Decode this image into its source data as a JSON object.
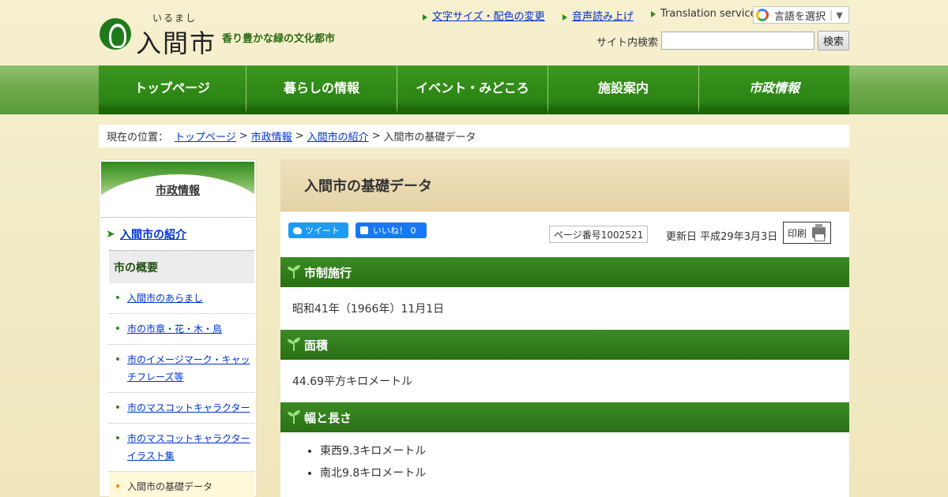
{
  "header": {
    "logo_ruby": "いるまし",
    "logo_name": "入間市",
    "tagline": "香り豊かな緑の文化都市",
    "util_links": [
      "文字サイズ・配色の変更",
      "音声読み上げ"
    ],
    "translation_label": "Translation service",
    "lang_select": "言語を選択",
    "search_label": "サイト内検索",
    "search_value": "",
    "search_button": "検索"
  },
  "nav": {
    "items": [
      "トップページ",
      "暮らしの情報",
      "イベント・みどころ",
      "施設案内",
      "市政情報"
    ]
  },
  "breadcrumb": {
    "label": "現在の位置：",
    "links": [
      "トップページ",
      "市政情報",
      "入間市の紹介"
    ],
    "current": "入間市の基礎データ",
    "sep": ">"
  },
  "sidebar": {
    "heading": "市政情報",
    "section": "入間市の紹介",
    "subsection": "市の概要",
    "items": [
      "入間市のあらまし",
      "市の市章・花・木・鳥",
      "市のイメージマーク・キャッチフレーズ等",
      "市のマスコットキャラクター",
      "市のマスコットキャラクターイラスト集",
      "入間市の基礎データ"
    ]
  },
  "main": {
    "title": "入間市の基礎データ",
    "tweet_label": "ツイート",
    "like_label": "いいね！ 0",
    "page_number": "ページ番号1002521",
    "updated": "更新日 平成29年3月3日",
    "print_label": "印刷",
    "sections": [
      {
        "heading": "市制施行",
        "body": "昭和41年（1966年）11月1日"
      },
      {
        "heading": "面積",
        "body": "44.69平方キロメートル"
      },
      {
        "heading": "幅と長さ",
        "list": [
          "東西9.3キロメートル",
          "南北9.8キロメートル"
        ]
      }
    ]
  }
}
